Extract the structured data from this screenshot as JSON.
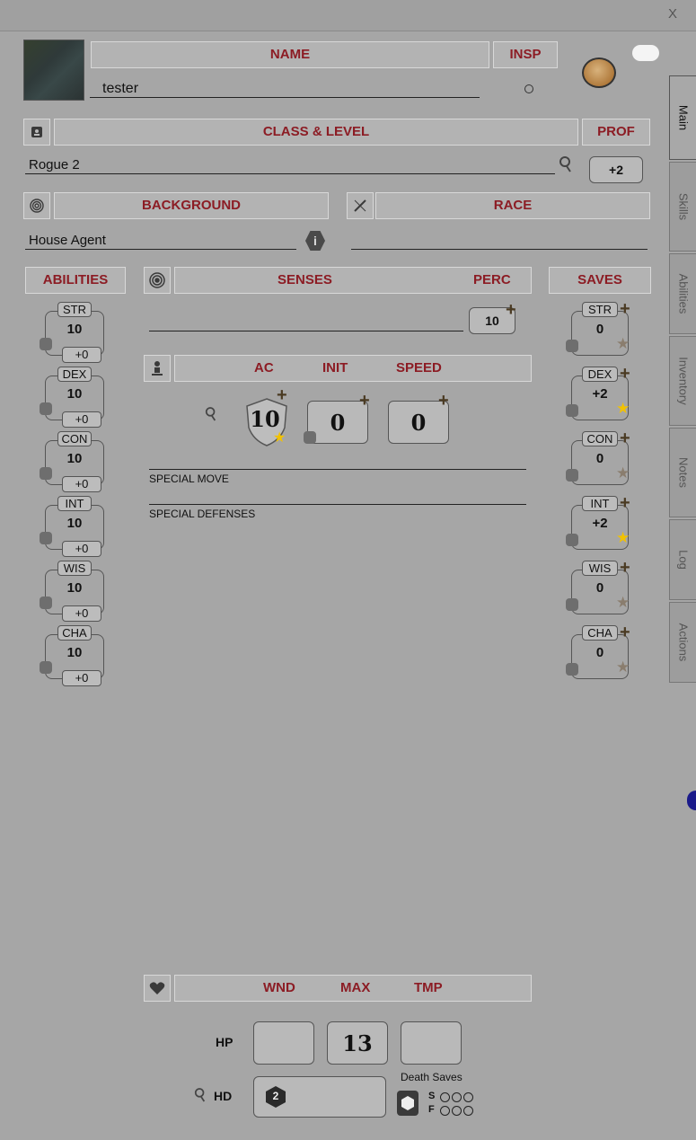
{
  "window": {
    "close_label": "X"
  },
  "character": {
    "name_header": "NAME",
    "name_value": "tester",
    "insp_header": "INSP",
    "class_header": "CLASS & LEVEL",
    "class_value": "Rogue 2",
    "prof_header": "PROF",
    "prof_value": "+2",
    "background_header": "BACKGROUND",
    "background_value": "House Agent",
    "race_header": "RACE",
    "race_value": ""
  },
  "abilities": {
    "header": "ABILITIES",
    "items": [
      {
        "label": "STR",
        "value": "10",
        "mod": "+0"
      },
      {
        "label": "DEX",
        "value": "10",
        "mod": "+0"
      },
      {
        "label": "CON",
        "value": "10",
        "mod": "+0"
      },
      {
        "label": "INT",
        "value": "10",
        "mod": "+0"
      },
      {
        "label": "WIS",
        "value": "10",
        "mod": "+0"
      },
      {
        "label": "CHA",
        "value": "10",
        "mod": "+0"
      }
    ]
  },
  "senses": {
    "header": "SENSES",
    "perc_header": "PERC",
    "perc_value": "10",
    "value": ""
  },
  "combat": {
    "ac_header": "AC",
    "init_header": "INIT",
    "speed_header": "SPEED",
    "ac_value": "10",
    "init_value": "0",
    "speed_value": "0",
    "special_move_label": "SPECIAL MOVE",
    "special_defenses_label": "SPECIAL DEFENSES"
  },
  "saves": {
    "header": "SAVES",
    "items": [
      {
        "label": "STR",
        "value": "0",
        "proficient": false
      },
      {
        "label": "DEX",
        "value": "+2",
        "proficient": true
      },
      {
        "label": "CON",
        "value": "0",
        "proficient": false
      },
      {
        "label": "INT",
        "value": "+2",
        "proficient": true
      },
      {
        "label": "WIS",
        "value": "0",
        "proficient": false
      },
      {
        "label": "CHA",
        "value": "0",
        "proficient": false
      }
    ]
  },
  "health": {
    "wnd_header": "WND",
    "max_header": "MAX",
    "tmp_header": "TMP",
    "hp_label": "HP",
    "wounds_value": "",
    "max_value": "13",
    "temp_value": "",
    "hd_label": "HD",
    "hd_value": "2",
    "death_saves_label": "Death Saves",
    "success_label": "S",
    "failure_label": "F"
  },
  "tabs": [
    "Main",
    "Skills",
    "Abilities",
    "Inventory",
    "Notes",
    "Log",
    "Actions"
  ],
  "colors": {
    "header_text": "#8c1c24",
    "proficient_star": "#f2c200",
    "star_off": "#8a7d6e"
  },
  "icons": [
    "portrait-image",
    "id-card-icon",
    "fingerprint-icon",
    "dna-icon",
    "info-icon",
    "radar-icon",
    "person-icon",
    "heart-icon",
    "magnifier-icon",
    "token-icon",
    "chat-bubble-icon",
    "d20-icon",
    "hexagon-die-icon"
  ]
}
